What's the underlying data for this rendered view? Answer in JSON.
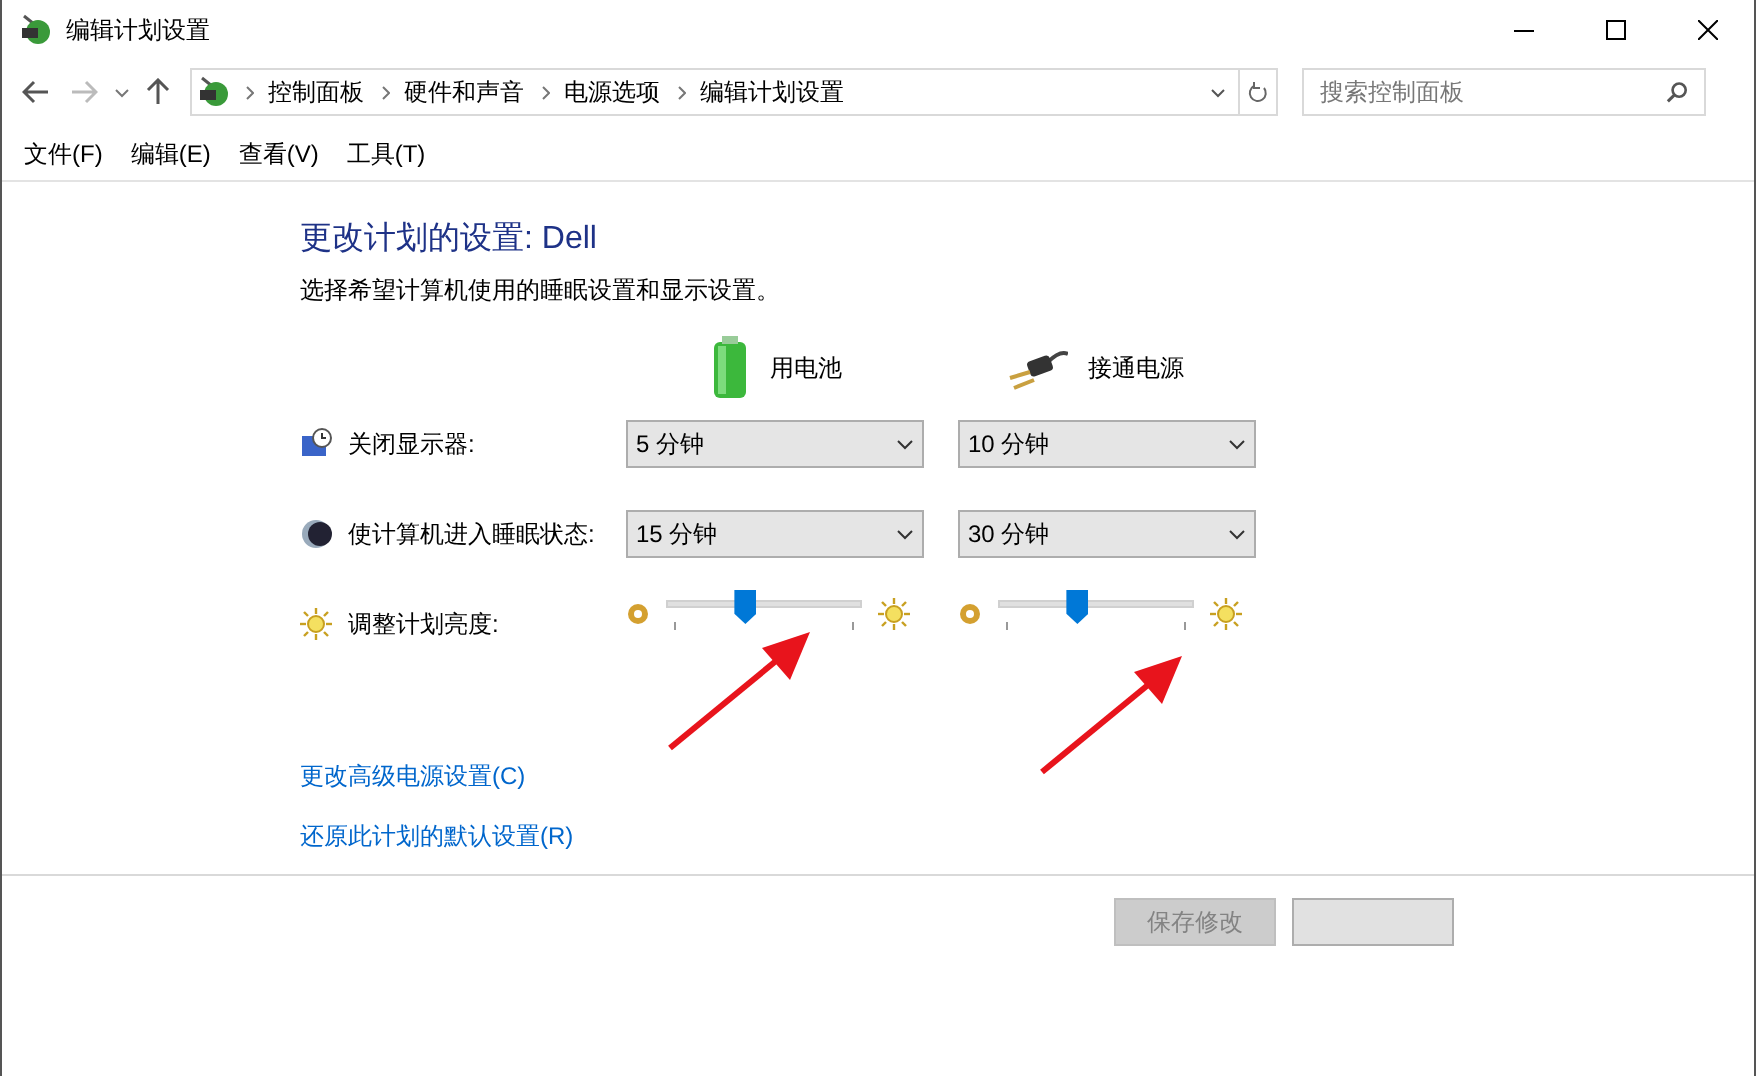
{
  "window": {
    "title": "编辑计划设置"
  },
  "breadcrumb": [
    "控制面板",
    "硬件和声音",
    "电源选项",
    "编辑计划设置"
  ],
  "search": {
    "placeholder": "搜索控制面板"
  },
  "menu": [
    "文件(F)",
    "编辑(E)",
    "查看(V)",
    "工具(T)"
  ],
  "heading": "更改计划的设置: Dell",
  "description": "选择希望计算机使用的睡眠设置和显示设置。",
  "columns": [
    {
      "kind": "battery",
      "label": "用电池"
    },
    {
      "kind": "plug",
      "label": "接通电源"
    }
  ],
  "settings": [
    {
      "kind": "dropdown",
      "label": "关闭显示器:",
      "values": [
        "5 分钟",
        "10 分钟"
      ]
    },
    {
      "kind": "dropdown",
      "label": "使计算机进入睡眠状态:",
      "values": [
        "15 分钟",
        "30 分钟"
      ]
    },
    {
      "kind": "slider",
      "label": "调整计划亮度:",
      "sliders": [
        {
          "level": 0.4
        },
        {
          "level": 0.4
        }
      ]
    }
  ],
  "links": [
    "更改高级电源设置(C)",
    "还原此计划的默认设置(R)"
  ],
  "buttons": [
    {
      "label": "保存修改",
      "disabled": true
    },
    {
      "disabled": false
    }
  ]
}
